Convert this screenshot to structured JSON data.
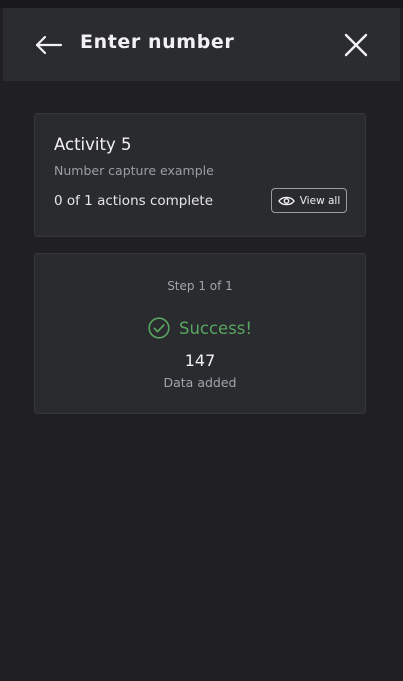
{
  "header": {
    "title": "Enter number",
    "back_icon": "arrow-left-icon",
    "close_icon": "close-icon"
  },
  "activity": {
    "title": "Activity 5",
    "subtitle": "Number capture example",
    "progress": "0 of 1 actions complete",
    "view_all_label": "View all",
    "view_all_icon": "eye-icon"
  },
  "step": {
    "label": "Step 1 of 1",
    "status": "Success!",
    "status_icon": "check-circle-icon",
    "value": "147",
    "caption": "Data added"
  },
  "colors": {
    "background": "#202023",
    "appbar": "#2b2c30",
    "card": "#2a2b2f",
    "success": "#59a55f"
  }
}
